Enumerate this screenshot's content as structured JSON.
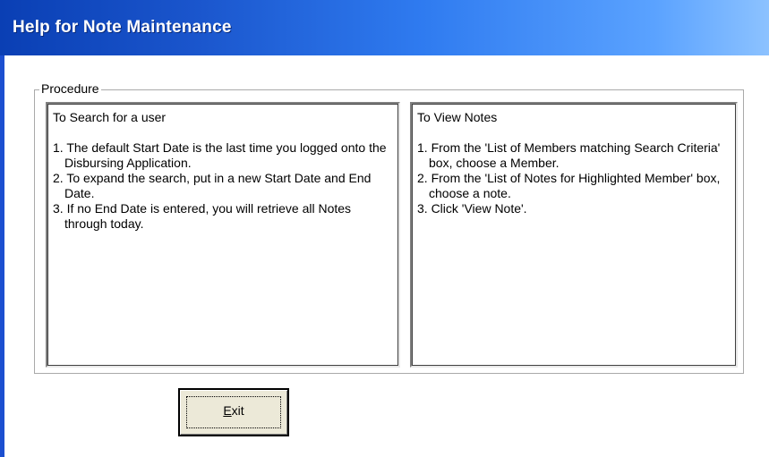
{
  "window": {
    "title": "Help for Note Maintenance"
  },
  "procedure": {
    "label": "Procedure",
    "search_panel": {
      "heading": "To Search for a user",
      "items": [
        "1. The default Start Date is the last time you logged onto the Disbursing Application.",
        "2. To expand the search, put in a new Start Date and End Date.",
        "3. If no End Date is entered, you will retrieve all Notes through today."
      ]
    },
    "view_panel": {
      "heading": "To View Notes",
      "items": [
        "1. From the 'List of Members matching Search Criteria' box, choose a Member.",
        "2. From the 'List of Notes for Highlighted Member' box, choose a note.",
        "3. Click 'View Note'."
      ]
    }
  },
  "exit_button": {
    "mnemonic": "E",
    "rest": "xit"
  },
  "colors": {
    "titlebar_start": "#0a3fb4",
    "titlebar_end": "#8cc2ff",
    "button_face": "#ece9d8"
  }
}
